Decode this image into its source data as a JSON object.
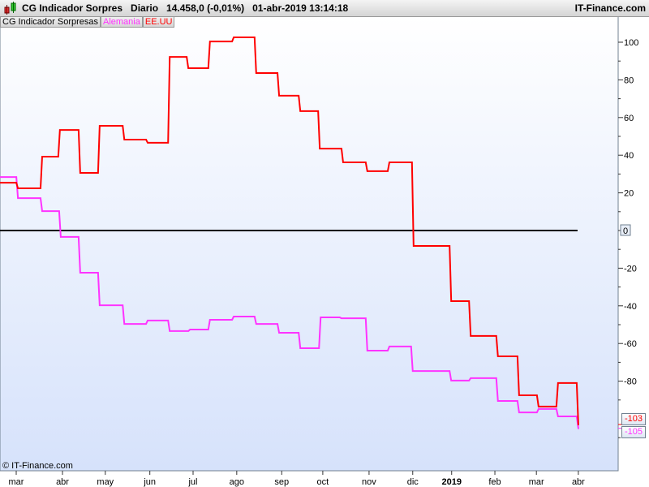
{
  "header": {
    "title": "CG Indicador Sorpres",
    "period": "Diario",
    "price": "14.458,0 (-0,01%)",
    "datetime": "01-abr-2019 13:14:18",
    "brand": "IT-Finance.com"
  },
  "legend": {
    "indicator": "CG Indicador Sorpresas",
    "series1": "Alemania",
    "series2": "EE.UU"
  },
  "copyright": "© IT-Finance.com",
  "colors": {
    "alemania": "#ff33ff",
    "eeuu": "#ff0000",
    "zero": "#000000"
  },
  "chart_data": {
    "type": "line",
    "title": "CG Indicador Sorpresas",
    "x_unit": "months since start of mar 2018",
    "xlim": [
      -0.38,
      13.45
    ],
    "ylim": [
      -128,
      113
    ],
    "yticks": [
      100,
      80,
      60,
      40,
      20,
      0,
      -20,
      -40,
      -60,
      -80
    ],
    "ytick_labels": [
      "100",
      "80",
      "60",
      "40",
      "20",
      "0",
      "-20",
      "-40",
      "-60",
      "-80"
    ],
    "xticks": [
      0,
      1.07,
      2.06,
      3.09,
      4.09,
      5.1,
      6.14,
      7.09,
      8.16,
      9.17,
      10.07,
      11.07,
      12.03,
      13.0
    ],
    "xtick_labels": [
      "mar",
      "abr",
      "may",
      "jun",
      "jul",
      "ago",
      "sep",
      "oct",
      "nov",
      "dic",
      "2019",
      "feb",
      "mar",
      "abr"
    ],
    "zero_line": 0,
    "last_labels": {
      "eeuu": "-103",
      "alemania": "-105"
    },
    "series": [
      {
        "name": "EE.UU",
        "color": "#ff0000",
        "end": 13.0,
        "steps": [
          [
            -0.38,
            25.4
          ],
          [
            0.04,
            22.4
          ],
          [
            0.6,
            39.2
          ],
          [
            1.01,
            53.4
          ],
          [
            1.48,
            30.6
          ],
          [
            1.93,
            55.6
          ],
          [
            2.5,
            48.3
          ],
          [
            3.04,
            46.6
          ],
          [
            3.55,
            92.2
          ],
          [
            3.98,
            86.2
          ],
          [
            4.48,
            100.4
          ],
          [
            5.03,
            102.6
          ],
          [
            5.55,
            83.6
          ],
          [
            6.08,
            71.6
          ],
          [
            6.57,
            63.4
          ],
          [
            7.02,
            43.5
          ],
          [
            7.56,
            36.2
          ],
          [
            8.12,
            31.5
          ],
          [
            8.63,
            36.2
          ],
          [
            9.19,
            -8.2
          ],
          [
            10.06,
            -37.5
          ],
          [
            10.51,
            -56
          ],
          [
            11.14,
            -66.8
          ],
          [
            11.63,
            -87.5
          ],
          [
            12.08,
            -93.5
          ],
          [
            12.53,
            -81
          ],
          [
            13.0,
            -103
          ]
        ]
      },
      {
        "name": "Alemania",
        "color": "#ff33ff",
        "end": 13.0,
        "steps": [
          [
            -0.38,
            28.4
          ],
          [
            0.04,
            17.2
          ],
          [
            0.6,
            10.3
          ],
          [
            1.03,
            -3.4
          ],
          [
            1.48,
            -22.4
          ],
          [
            1.93,
            -39.7
          ],
          [
            2.5,
            -49.6
          ],
          [
            3.04,
            -47.8
          ],
          [
            3.55,
            -53.4
          ],
          [
            4.02,
            -52.6
          ],
          [
            4.48,
            -47.4
          ],
          [
            5.03,
            -45.7
          ],
          [
            5.55,
            -49.6
          ],
          [
            6.08,
            -54.3
          ],
          [
            6.57,
            -62.5
          ],
          [
            7.04,
            -46.1
          ],
          [
            7.52,
            -46.6
          ],
          [
            8.12,
            -63.8
          ],
          [
            8.63,
            -61.6
          ],
          [
            9.17,
            -74.6
          ],
          [
            10.06,
            -79.7
          ],
          [
            10.51,
            -78.4
          ],
          [
            11.14,
            -90.5
          ],
          [
            11.63,
            -96.6
          ],
          [
            12.08,
            -94.8
          ],
          [
            12.53,
            -98.7
          ],
          [
            13.0,
            -105
          ]
        ]
      }
    ]
  }
}
